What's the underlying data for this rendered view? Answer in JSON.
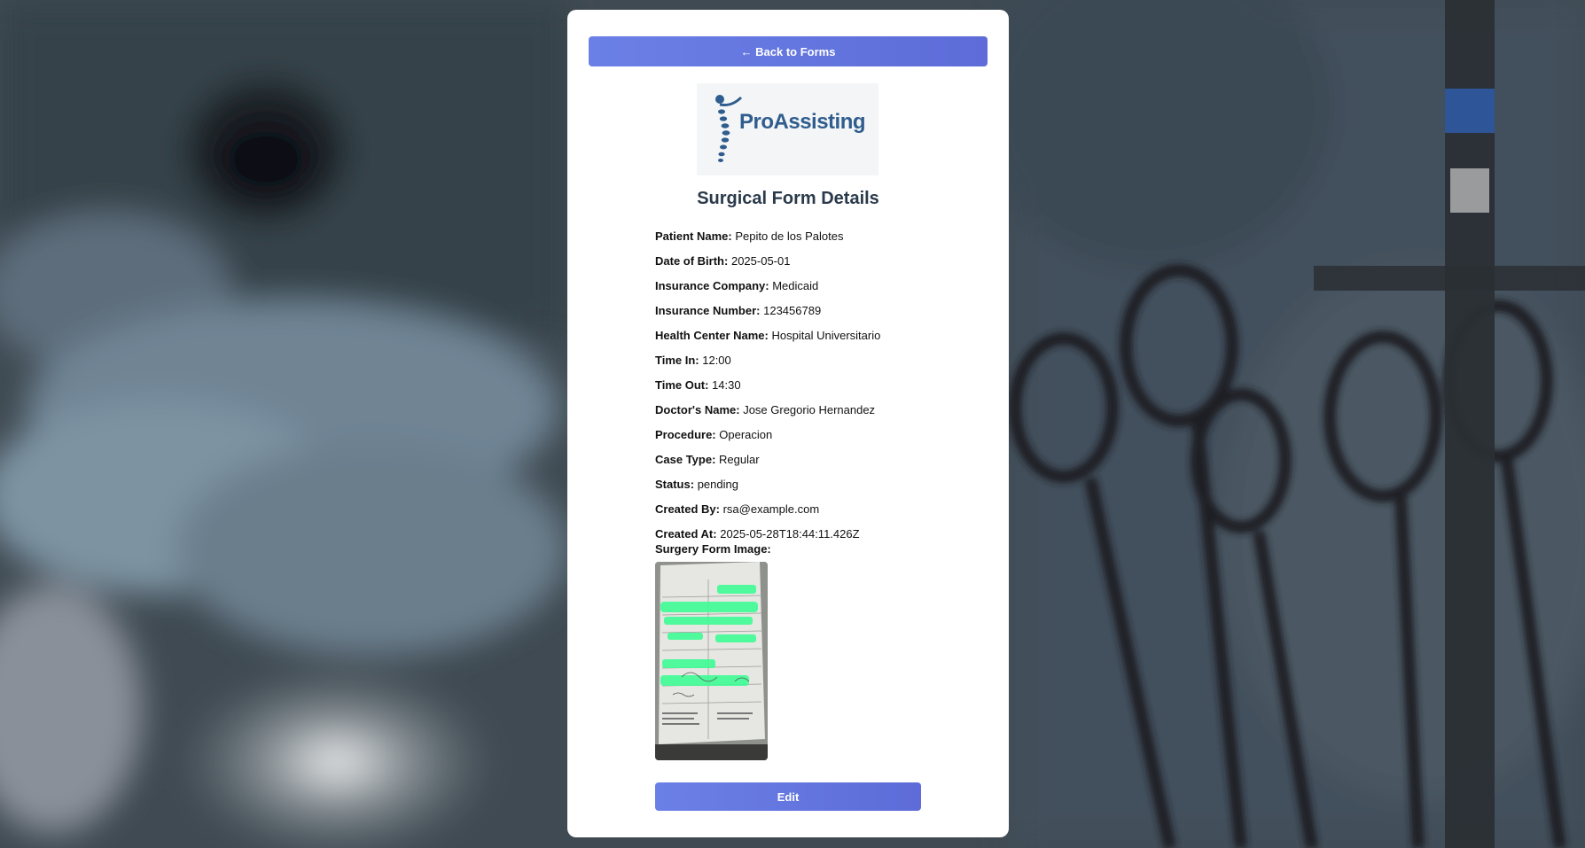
{
  "nav": {
    "back_label": "← Back to Forms"
  },
  "logo": {
    "text": "ProAssisting",
    "icon": "spine-figure-logo"
  },
  "page": {
    "title": "Surgical Form Details"
  },
  "fields": [
    {
      "label": "Patient Name:",
      "value": "Pepito de los Palotes"
    },
    {
      "label": "Date of Birth:",
      "value": "2025-05-01"
    },
    {
      "label": "Insurance Company:",
      "value": "Medicaid"
    },
    {
      "label": "Insurance Number:",
      "value": "123456789"
    },
    {
      "label": "Health Center Name:",
      "value": "Hospital Universitario"
    },
    {
      "label": "Time In:",
      "value": "12:00"
    },
    {
      "label": "Time Out:",
      "value": "14:30"
    },
    {
      "label": "Doctor's Name:",
      "value": "Jose Gregorio Hernandez"
    },
    {
      "label": "Procedure:",
      "value": "Operacion"
    },
    {
      "label": "Case Type:",
      "value": "Regular"
    },
    {
      "label": "Status:",
      "value": "pending"
    },
    {
      "label": "Created By:",
      "value": "rsa@example.com"
    },
    {
      "label": "Created At:",
      "value": "2025-05-28T18:44:11.426Z"
    }
  ],
  "image_section": {
    "label": "Surgery Form Image:"
  },
  "actions": {
    "edit_label": "Edit"
  },
  "colors": {
    "button": "#6474e0",
    "logo_text": "#2f5d8e",
    "title": "#2a3a4a"
  }
}
